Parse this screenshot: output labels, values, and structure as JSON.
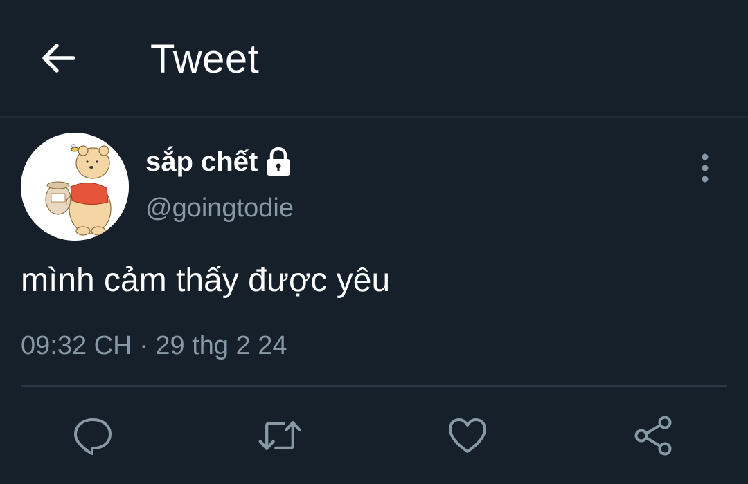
{
  "header": {
    "title": "Tweet"
  },
  "author": {
    "display_name": "sắp chết",
    "handle": "@goingtodie",
    "protected": true
  },
  "tweet": {
    "text": "mình cảm thấy được yêu",
    "time": "09:32 CH",
    "separator": "·",
    "date": "29 thg 2 24"
  },
  "actions": [
    "reply-icon",
    "retweet-icon",
    "like-icon",
    "share-icon"
  ],
  "colors": {
    "background": "#15202b",
    "text_primary": "#ffffff",
    "text_secondary": "#8899a6",
    "divider": "#2c3845"
  }
}
